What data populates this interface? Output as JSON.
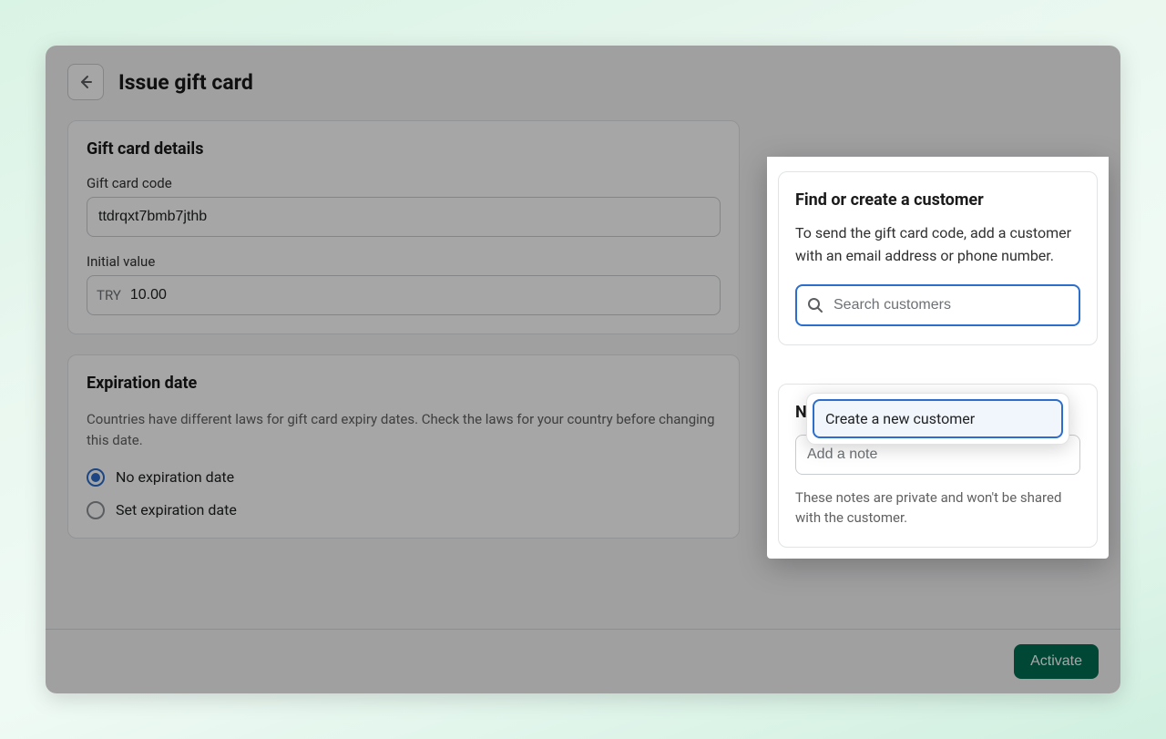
{
  "header": {
    "title": "Issue gift card"
  },
  "details": {
    "title": "Gift card details",
    "code_label": "Gift card code",
    "code_value": "ttdrqxt7bmb7jthb",
    "value_label": "Initial value",
    "currency": "TRY",
    "value_amount": "10.00"
  },
  "expiration": {
    "title": "Expiration date",
    "help": "Countries have different laws for gift card expiry dates. Check the laws for your country before changing this date.",
    "option_none": "No expiration date",
    "option_set": "Set expiration date"
  },
  "customer": {
    "title": "Find or create a customer",
    "desc": "To send the gift card code, add a customer with an email address or phone number.",
    "search_placeholder": "Search customers",
    "create_label": "Create a new customer"
  },
  "notes": {
    "title": "Notes",
    "placeholder": "Add a note",
    "help": "These notes are private and won't be shared with the customer."
  },
  "footer": {
    "activate": "Activate"
  }
}
